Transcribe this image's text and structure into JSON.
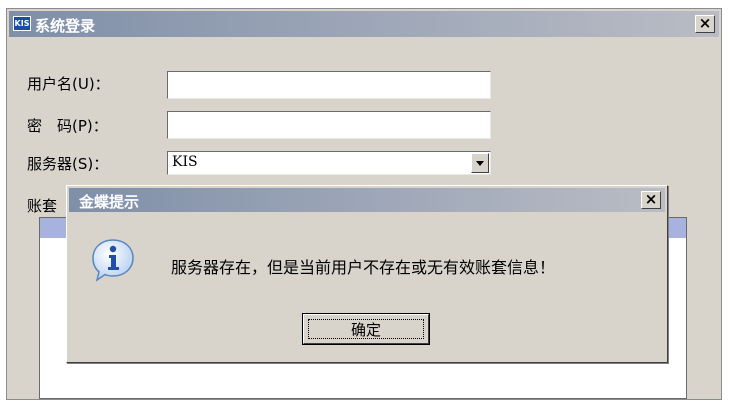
{
  "login_window": {
    "logo_text": "KIS",
    "title": "系统登录",
    "close_glyph": "×",
    "fields": {
      "username_label": "用户名(U)：",
      "username_value": "",
      "password_label": "密　码(P)：",
      "password_value": "",
      "server_label": "服务器(S)：",
      "server_value": "KIS"
    },
    "account_label": "账套"
  },
  "alert_dialog": {
    "title": "金蝶提示",
    "close_glyph": "×",
    "icon": "info-icon",
    "message": "服务器存在，但是当前用户不存在或无有效账套信息！",
    "ok_label": "确定"
  },
  "colors": {
    "title_bar": "#7f8fa8",
    "window_face": "#d8d4cc",
    "list_header": "#a8b2de"
  }
}
